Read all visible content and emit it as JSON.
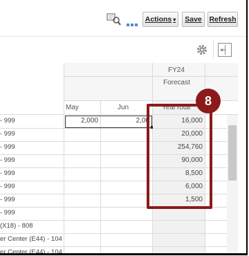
{
  "toolbar": {
    "review_icon": "review-search-icon",
    "more_icon": "more-dots-icon",
    "actions_label": "Actions",
    "actions_caret": "▾",
    "save_label": "Save",
    "refresh_label": "Refresh"
  },
  "grid": {
    "header": {
      "year": "FY24",
      "scenario": "Forecast",
      "columns": [
        "May",
        "Jun",
        "YearTotal"
      ]
    },
    "rows": [
      {
        "label": "- 999",
        "may": "2,000",
        "jun": "2,00",
        "year_total": "16,000"
      },
      {
        "label": "- 999",
        "may": "",
        "jun": "",
        "year_total": "20,000"
      },
      {
        "label": "- 999",
        "may": "",
        "jun": "",
        "year_total": "254,760"
      },
      {
        "label": "- 999",
        "may": "",
        "jun": "",
        "year_total": "90,000"
      },
      {
        "label": "- 999",
        "may": "",
        "jun": "",
        "year_total": "8,500"
      },
      {
        "label": "- 999",
        "may": "",
        "jun": "",
        "year_total": "6,000"
      },
      {
        "label": "- 999",
        "may": "",
        "jun": "",
        "year_total": "1,500"
      },
      {
        "label": "- 999",
        "may": "",
        "jun": "",
        "year_total": ""
      },
      {
        "label": "(X18) - 808",
        "may": "",
        "jun": "",
        "year_total": ""
      },
      {
        "label": "er Center (E44) - 104",
        "may": "",
        "jun": "",
        "year_total": ""
      },
      {
        "label": "er Center (E44) - 104",
        "may": "",
        "jun": "",
        "year_total": ""
      }
    ]
  },
  "callout": {
    "number": "8",
    "color": "#8b1a1a"
  }
}
